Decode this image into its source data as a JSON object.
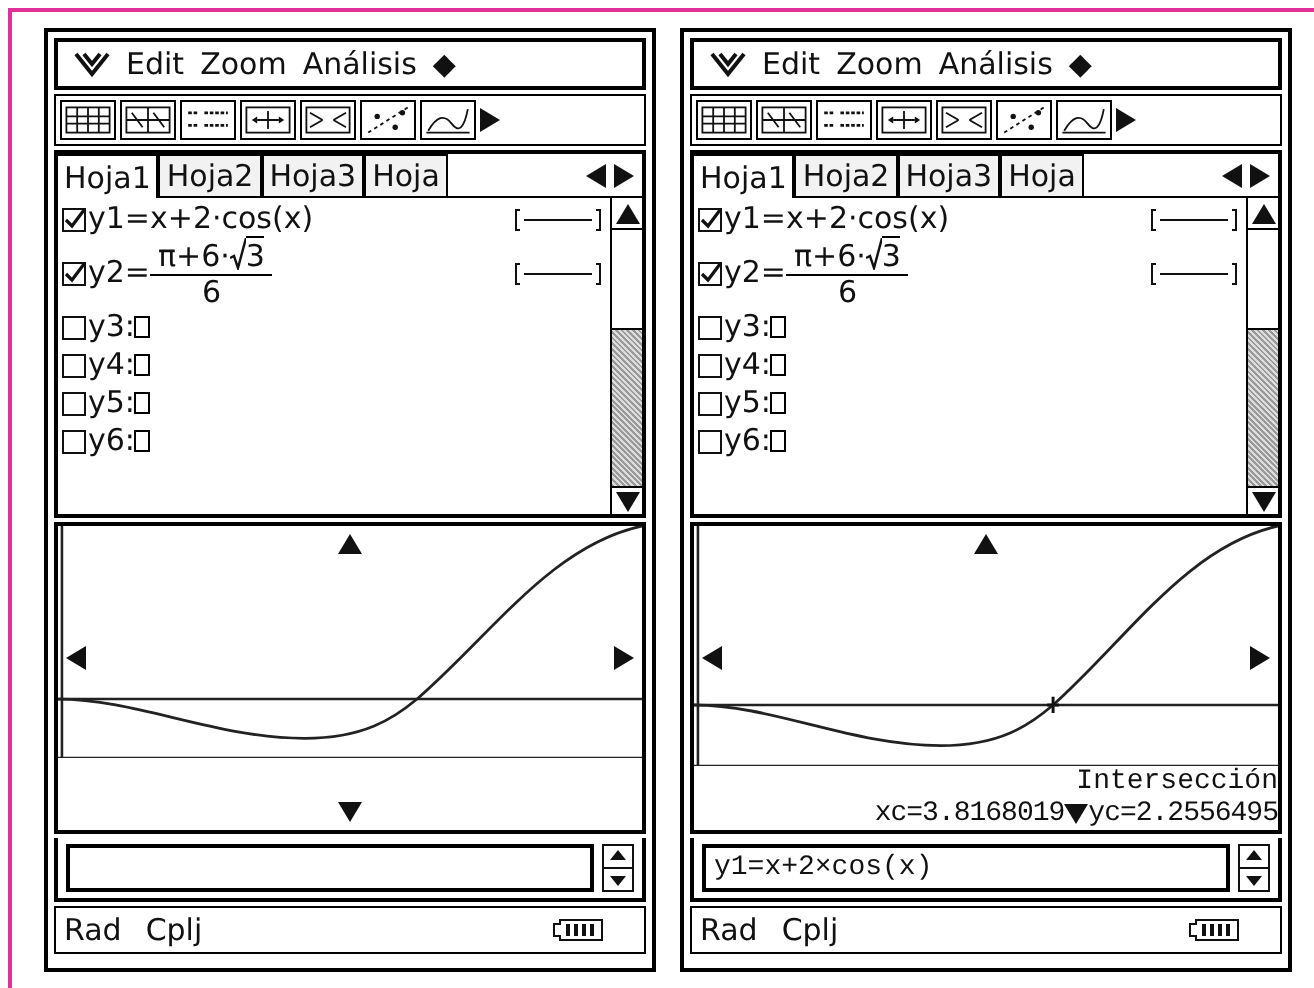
{
  "screens": [
    {
      "menu": {
        "items": [
          "Edit",
          "Zoom",
          "Análisis",
          "◆"
        ]
      },
      "tabs": [
        {
          "label": "Hoja1",
          "selected": true
        },
        {
          "label": "Hoja2",
          "selected": false
        },
        {
          "label": "Hoja3",
          "selected": false
        },
        {
          "label": "Hoja",
          "selected": false
        }
      ],
      "functions": [
        {
          "label": "y1=",
          "checked": true,
          "kind": "expression",
          "expr": "x+2·cos(x)",
          "line_style": true
        },
        {
          "label": "y2=",
          "checked": true,
          "kind": "fraction",
          "numerator": "π+6·",
          "radicand": "3",
          "denominator": "6",
          "line_style": true
        },
        {
          "label": "y3:",
          "checked": false,
          "kind": "empty"
        },
        {
          "label": "y4:",
          "checked": false,
          "kind": "empty"
        },
        {
          "label": "y5:",
          "checked": false,
          "kind": "empty"
        },
        {
          "label": "y6:",
          "checked": false,
          "kind": "empty"
        }
      ],
      "status": {
        "items": [
          "Rad",
          "Cplj"
        ]
      }
    },
    {
      "menu": {
        "items": [
          "Edit",
          "Zoom",
          "Análisis",
          "◆"
        ]
      },
      "tabs": [
        {
          "label": "Hoja1",
          "selected": true
        },
        {
          "label": "Hoja2",
          "selected": false
        },
        {
          "label": "Hoja3",
          "selected": false
        },
        {
          "label": "Hoja",
          "selected": false
        }
      ],
      "functions": [
        {
          "label": "y1=",
          "checked": true,
          "kind": "expression",
          "expr": "x+2·cos(x)",
          "line_style": true
        },
        {
          "label": "y2=",
          "checked": true,
          "kind": "fraction",
          "numerator": "π+6·",
          "radicand": "3",
          "denominator": "6",
          "line_style": true
        },
        {
          "label": "y3:",
          "checked": false,
          "kind": "empty"
        },
        {
          "label": "y4:",
          "checked": false,
          "kind": "empty"
        },
        {
          "label": "y5:",
          "checked": false,
          "kind": "empty"
        },
        {
          "label": "y6:",
          "checked": false,
          "kind": "empty"
        }
      ],
      "graph": {
        "result": {
          "title": "Intersección",
          "xc": "xc=3.8168019",
          "yc": "yc=2.2556495"
        }
      },
      "entry": {
        "value": "y1=x+2×cos(x)"
      },
      "status": {
        "items": [
          "Rad",
          "Cplj"
        ]
      }
    }
  ]
}
